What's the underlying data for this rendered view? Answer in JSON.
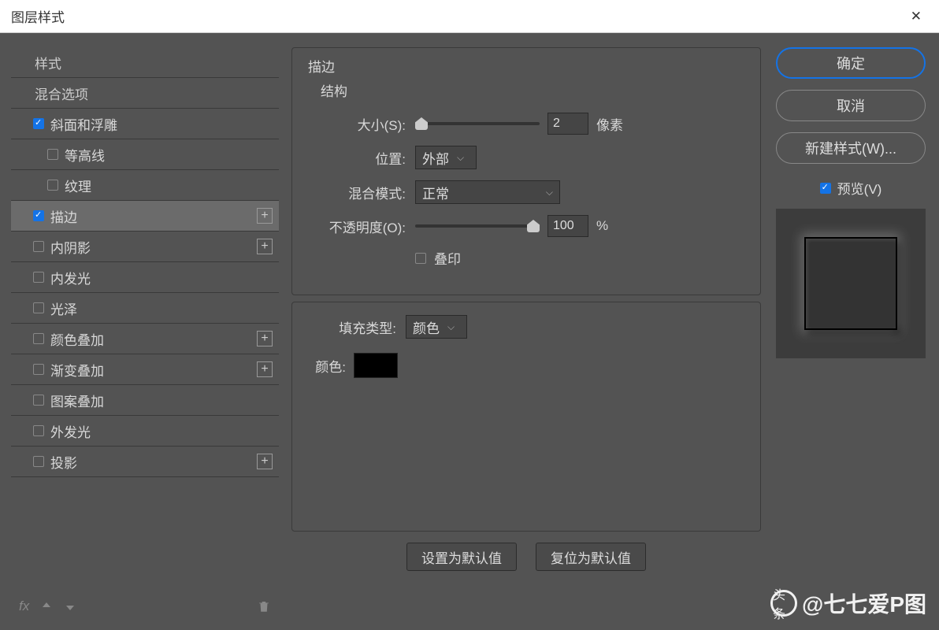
{
  "title": "图层样式",
  "left": {
    "header_styles": "样式",
    "header_blend": "混合选项",
    "items": [
      {
        "label": "斜面和浮雕",
        "checked": true,
        "plus": false
      },
      {
        "label": "等高线",
        "checked": false,
        "plus": false,
        "sub": true
      },
      {
        "label": "纹理",
        "checked": false,
        "plus": false,
        "sub": true
      },
      {
        "label": "描边",
        "checked": true,
        "plus": true,
        "selected": true
      },
      {
        "label": "内阴影",
        "checked": false,
        "plus": true
      },
      {
        "label": "内发光",
        "checked": false,
        "plus": false
      },
      {
        "label": "光泽",
        "checked": false,
        "plus": false
      },
      {
        "label": "颜色叠加",
        "checked": false,
        "plus": true
      },
      {
        "label": "渐变叠加",
        "checked": false,
        "plus": true
      },
      {
        "label": "图案叠加",
        "checked": false,
        "plus": false
      },
      {
        "label": "外发光",
        "checked": false,
        "plus": false
      },
      {
        "label": "投影",
        "checked": false,
        "plus": true
      }
    ],
    "fx": "fx"
  },
  "center": {
    "section": "描边",
    "sub": "结构",
    "size_label": "大小(S):",
    "size_value": "2",
    "size_unit": "像素",
    "position_label": "位置:",
    "position_value": "外部",
    "blend_label": "混合模式:",
    "blend_value": "正常",
    "opacity_label": "不透明度(O):",
    "opacity_value": "100",
    "opacity_unit": "%",
    "overprint_label": "叠印",
    "fill_type_label": "填充类型:",
    "fill_type_value": "颜色",
    "color_label": "颜色:",
    "set_default": "设置为默认值",
    "reset_default": "复位为默认值"
  },
  "right": {
    "ok": "确定",
    "cancel": "取消",
    "new_style": "新建样式(W)...",
    "preview_label": "预览(V)"
  },
  "watermark": {
    "prefix": "头条",
    "user": "@七七爱P图"
  }
}
